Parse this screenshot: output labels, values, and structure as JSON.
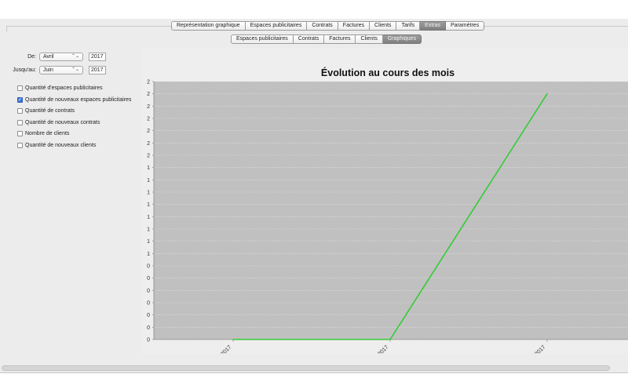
{
  "main_tabs": [
    {
      "label": "Représentation graphique",
      "active": false
    },
    {
      "label": "Espaces publicitaires",
      "active": false
    },
    {
      "label": "Contrats",
      "active": false
    },
    {
      "label": "Factures",
      "active": false
    },
    {
      "label": "Clients",
      "active": false
    },
    {
      "label": "Tarifs",
      "active": false
    },
    {
      "label": "Extras",
      "active": true
    },
    {
      "label": "Paramètres",
      "active": false
    }
  ],
  "sub_tabs": [
    {
      "label": "Espaces publicitaires",
      "active": false
    },
    {
      "label": "Contrats",
      "active": false
    },
    {
      "label": "Factures",
      "active": false
    },
    {
      "label": "Clients",
      "active": false
    },
    {
      "label": "Graphiques",
      "active": true
    }
  ],
  "filters": {
    "from_label": "De:",
    "from_month": "Avril",
    "from_year": "2017",
    "to_label": "Jusqu'au:",
    "to_month": "Juin",
    "to_year": "2017"
  },
  "checkboxes": [
    {
      "label": "Quantité d'espaces publicitaires",
      "checked": false
    },
    {
      "label": "Quantité de nouveaux espaces publicitaires",
      "checked": true
    },
    {
      "label": "Quantité de contrats",
      "checked": false
    },
    {
      "label": "Quantité de nouveaux contrats",
      "checked": false
    },
    {
      "label": "Nombre de clients",
      "checked": false
    },
    {
      "label": "Quantité de nouveaux clients",
      "checked": false
    }
  ],
  "chart_data": {
    "type": "line",
    "title": "Évolution au cours des mois",
    "xlabel": "",
    "ylabel": "",
    "categories": [
      "04.2017",
      "05.2017",
      "06.2017"
    ],
    "series": [
      {
        "name": "Quantité de nouveaux espaces publicitaires",
        "values": [
          0,
          0,
          2
        ],
        "color": "#33cc33"
      }
    ],
    "y_tick_labels": [
      "0",
      "0",
      "0",
      "0",
      "0",
      "0",
      "0",
      "1",
      "1",
      "1",
      "1",
      "1",
      "1",
      "1",
      "1",
      "2",
      "2",
      "2",
      "2",
      "2",
      "2",
      "2"
    ],
    "ylim": [
      0,
      2.1
    ],
    "grid": true,
    "legend_position": "bottom",
    "plot_background": "#c0c0c0"
  }
}
